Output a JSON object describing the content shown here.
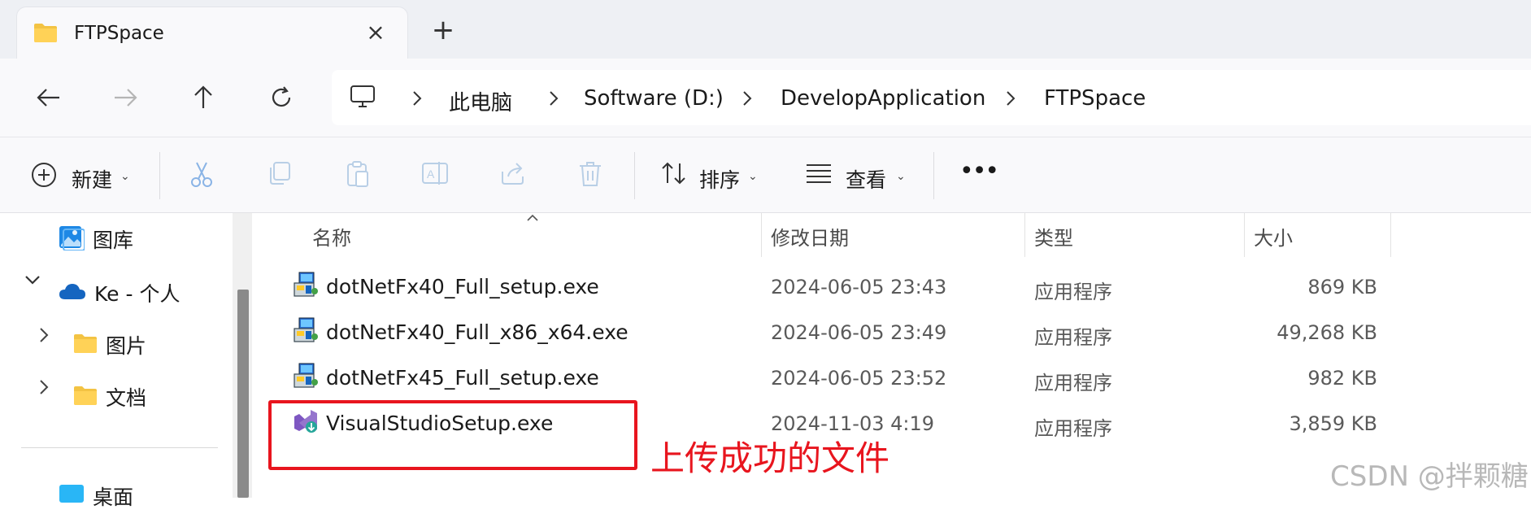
{
  "tab": {
    "title": "FTPSpace",
    "close_icon": "close-icon",
    "new_tab_icon": "plus-icon"
  },
  "nav": {
    "back_icon": "arrow-left-icon",
    "forward_icon": "arrow-right-icon",
    "up_icon": "arrow-up-icon",
    "refresh_icon": "refresh-icon"
  },
  "breadcrumb": {
    "root_icon": "monitor-icon",
    "items": [
      "此电脑",
      "Software (D:)",
      "DevelopApplication",
      "FTPSpace"
    ]
  },
  "toolbar": {
    "new_label": "新建",
    "sort_label": "排序",
    "view_label": "查看",
    "more_label": "•••"
  },
  "sidebar": {
    "items": [
      {
        "label": "图库",
        "icon": "gallery-icon"
      },
      {
        "label": "Ke - 个人",
        "icon": "onedrive-cloud-icon"
      },
      {
        "label": "图片",
        "icon": "folder-icon"
      },
      {
        "label": "文档",
        "icon": "folder-icon"
      },
      {
        "label": "桌面",
        "icon": "desktop-icon"
      }
    ]
  },
  "columns": {
    "name": "名称",
    "date": "修改日期",
    "type": "类型",
    "size": "大小"
  },
  "files": [
    {
      "name": "dotNetFx40_Full_setup.exe",
      "date": "2024-06-05 23:43",
      "type": "应用程序",
      "size": "869 KB",
      "icon": "installer-icon"
    },
    {
      "name": "dotNetFx40_Full_x86_x64.exe",
      "date": "2024-06-05 23:49",
      "type": "应用程序",
      "size": "49,268 KB",
      "icon": "installer-icon"
    },
    {
      "name": "dotNetFx45_Full_setup.exe",
      "date": "2024-06-05 23:52",
      "type": "应用程序",
      "size": "982 KB",
      "icon": "installer-icon"
    },
    {
      "name": "VisualStudioSetup.exe",
      "date": "2024-11-03 4:19",
      "type": "应用程序",
      "size": "3,859 KB",
      "icon": "visual-studio-icon"
    }
  ],
  "annotation": {
    "text": "上传成功的文件",
    "color": "#e8151e"
  },
  "watermark": "CSDN @拌颗糖",
  "colors": {
    "accent": "#0067c0",
    "annotation_red": "#e8151e"
  }
}
